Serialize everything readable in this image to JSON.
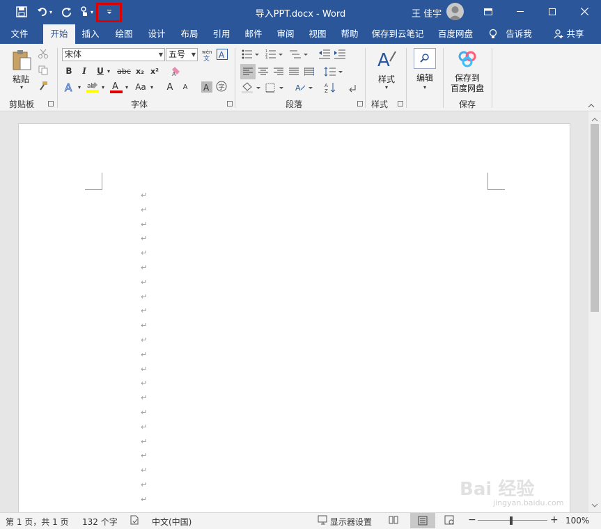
{
  "window": {
    "doc_title": "导入PPT.docx  -  Word",
    "user_name": "王 佳宇"
  },
  "qat": {
    "save_icon": "save-icon",
    "undo_icon": "undo-icon",
    "redo_icon": "redo-icon",
    "touch_icon": "touch-mode-icon",
    "customize_icon": "customize-qat-icon"
  },
  "tabs": [
    {
      "label": "文件"
    },
    {
      "label": "开始"
    },
    {
      "label": "插入"
    },
    {
      "label": "绘图"
    },
    {
      "label": "设计"
    },
    {
      "label": "布局"
    },
    {
      "label": "引用"
    },
    {
      "label": "邮件"
    },
    {
      "label": "审阅"
    },
    {
      "label": "视图"
    },
    {
      "label": "帮助"
    },
    {
      "label": "保存到云笔记"
    },
    {
      "label": "百度网盘"
    },
    {
      "label": "告诉我"
    },
    {
      "label": "共享"
    }
  ],
  "ribbon": {
    "clipboard": {
      "paste_label": "粘贴",
      "group_label": "剪贴板"
    },
    "font": {
      "font_name": "宋体",
      "font_size": "五号",
      "bold": "B",
      "italic": "I",
      "underline": "U",
      "strike": "abc",
      "subscript": "x₂",
      "superscript": "x²",
      "grow": "A",
      "shrink": "A",
      "change_case": "Aa",
      "group_label": "字体"
    },
    "paragraph": {
      "group_label": "段落"
    },
    "styles": {
      "label": "样式",
      "group_label": "样式"
    },
    "editing": {
      "label": "编辑"
    },
    "save": {
      "label_line1": "保存到",
      "label_line2": "百度网盘",
      "group_label": "保存"
    }
  },
  "status": {
    "page": "第 1 页，共 1 页",
    "words": "132 个字",
    "language": "中文(中国)",
    "display_settings": "显示器设置",
    "zoom_minus": "−",
    "zoom_plus": "+",
    "zoom": "100%"
  },
  "document": {
    "paragraph_mark": "↵"
  },
  "colors": {
    "accent": "#2b579a",
    "highlight": "#e00000"
  },
  "watermark": {
    "main": "Bai 经验",
    "sub": "jingyan.baidu.com"
  }
}
